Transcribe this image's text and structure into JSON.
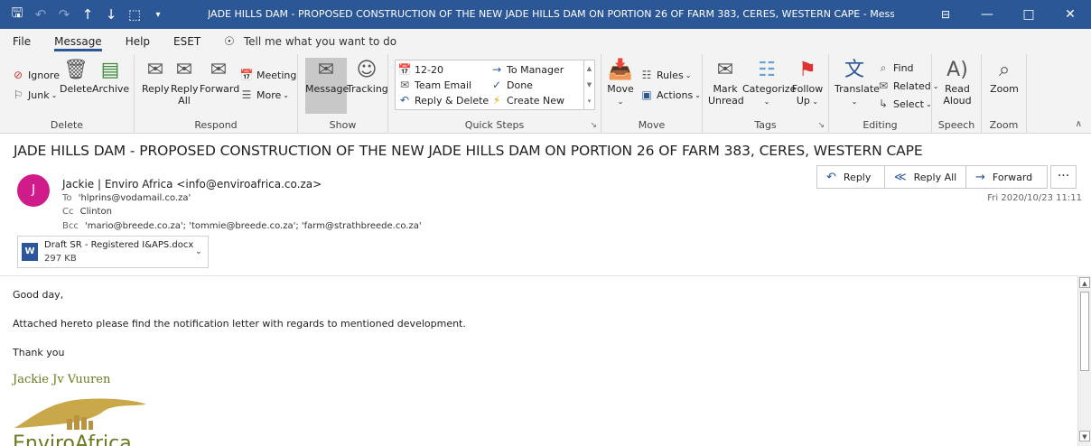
{
  "window": {
    "title": "JADE HILLS DAM - PROPOSED CONSTRUCTION OF THE NEW JADE HILLS DAM ON PORTION 26 OF FARM 383, CERES, WESTERN CAPE  -  Message (HTML)",
    "quick_access": [
      "save-icon",
      "undo-icon",
      "redo-icon",
      "up-arrow-icon",
      "down-arrow-icon",
      "share-icon",
      "customize-icon"
    ],
    "controls": [
      "restore-ribbon-icon",
      "minimize-icon",
      "maximize-icon",
      "close-icon"
    ]
  },
  "menu": {
    "tabs": [
      "File",
      "Message",
      "Help",
      "ESET"
    ],
    "active": "Message",
    "tell_me": "Tell me what you want to do"
  },
  "ribbon": {
    "groups": {
      "delete": "Delete",
      "respond": "Respond",
      "show": "Show",
      "quick_steps": "Quick Steps",
      "move": "Move",
      "tags": "Tags",
      "editing": "Editing",
      "speech": "Speech",
      "zoom": "Zoom"
    },
    "buttons": {
      "ignore": "Ignore",
      "junk": "Junk",
      "delete": "Delete",
      "archive": "Archive",
      "reply": "Reply",
      "reply_all_1": "Reply",
      "reply_all_2": "All",
      "forward": "Forward",
      "meeting": "Meeting",
      "more": "More",
      "message": "Message",
      "tracking": "Tracking",
      "qs_1": "12-20",
      "qs_2": "Team Email",
      "qs_3": "Reply & Delete",
      "qs_4": "To Manager",
      "qs_5": "Done",
      "qs_6": "Create New",
      "move": "Move",
      "rules": "Rules",
      "actions": "Actions",
      "mark_unread_1": "Mark",
      "mark_unread_2": "Unread",
      "categorize": "Categorize",
      "follow_up_1": "Follow",
      "follow_up_2": "Up",
      "translate": "Translate",
      "find": "Find",
      "related": "Related",
      "select": "Select",
      "read_aloud_1": "Read",
      "read_aloud_2": "Aloud",
      "zoom": "Zoom"
    }
  },
  "message": {
    "subject": "JADE HILLS DAM - PROPOSED CONSTRUCTION OF THE NEW JADE HILLS DAM ON PORTION 26 OF FARM 383, CERES, WESTERN CAPE",
    "avatar_initial": "J",
    "avatar_color": "#d01c8b",
    "from": "Jackie | Enviro Africa <info@enviroafrica.co.za>",
    "to_label": "To",
    "to": "'hlprins@vodamail.co.za'",
    "cc_label": "Cc",
    "cc": "Clinton",
    "bcc_label": "Bcc",
    "bcc": "'mario@breede.co.za'; 'tommie@breede.co.za'; 'farm@strathbreede.co.za'",
    "date": "Fri 2020/10/23 11:11",
    "actions": {
      "reply": "Reply",
      "reply_all": "Reply All",
      "forward": "Forward",
      "more": "···"
    },
    "attachment": {
      "name": "Draft SR - Registered I&APS.docx",
      "size": "297 KB",
      "icon_letter": "W"
    },
    "body": {
      "greeting": "Good day,",
      "line1": "Attached hereto please find the notification letter with regards to mentioned development.",
      "closing": "Thank you",
      "signature": "Jackie Jv Vuuren",
      "logo_text": "EnviroAfrica"
    }
  },
  "colors": {
    "titlebar": "#2b5797",
    "ribbon_bg": "#f3f3f3",
    "signature": "#6b7a1c",
    "logo_gold": "#c9a84a"
  }
}
